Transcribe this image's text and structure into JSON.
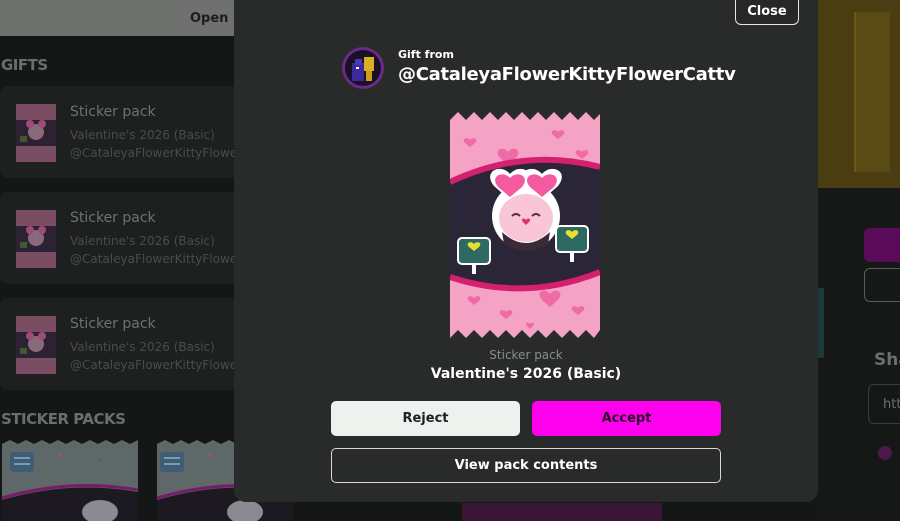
{
  "background": {
    "open_button_label": "Open S",
    "gifts_title": "GIFTS",
    "gifts": [
      {
        "title": "Sticker pack",
        "subtitle": "Valentine's 2026 (Basic)",
        "user": "@CataleyaFlowerKittyFlower"
      },
      {
        "title": "Sticker pack",
        "subtitle": "Valentine's 2026 (Basic)",
        "user": "@CataleyaFlowerKittyFlower"
      },
      {
        "title": "Sticker pack",
        "subtitle": "Valentine's 2026 (Basic)",
        "user": "@CataleyaFlowerKittyFlower"
      }
    ],
    "sticker_packs_title": "STICKER PACKS",
    "right_heading": "Sha",
    "right_field_text": "htt"
  },
  "modal": {
    "close_label": "Close",
    "gift_from_label": "Gift from",
    "sender": "@CataleyaFlowerKittyFlowerCattv",
    "pack_type": "Sticker pack",
    "pack_name": "Valentine's 2026 (Basic)",
    "reject_label": "Reject",
    "accept_label": "Accept",
    "view_contents_label": "View pack contents"
  },
  "colors": {
    "accent": "#ff00ee",
    "modal_bg": "#292b2a",
    "reject_bg": "#eff1ee"
  },
  "icons": [
    "avatar",
    "sticker-pack-art",
    "pack-thumbnail"
  ]
}
